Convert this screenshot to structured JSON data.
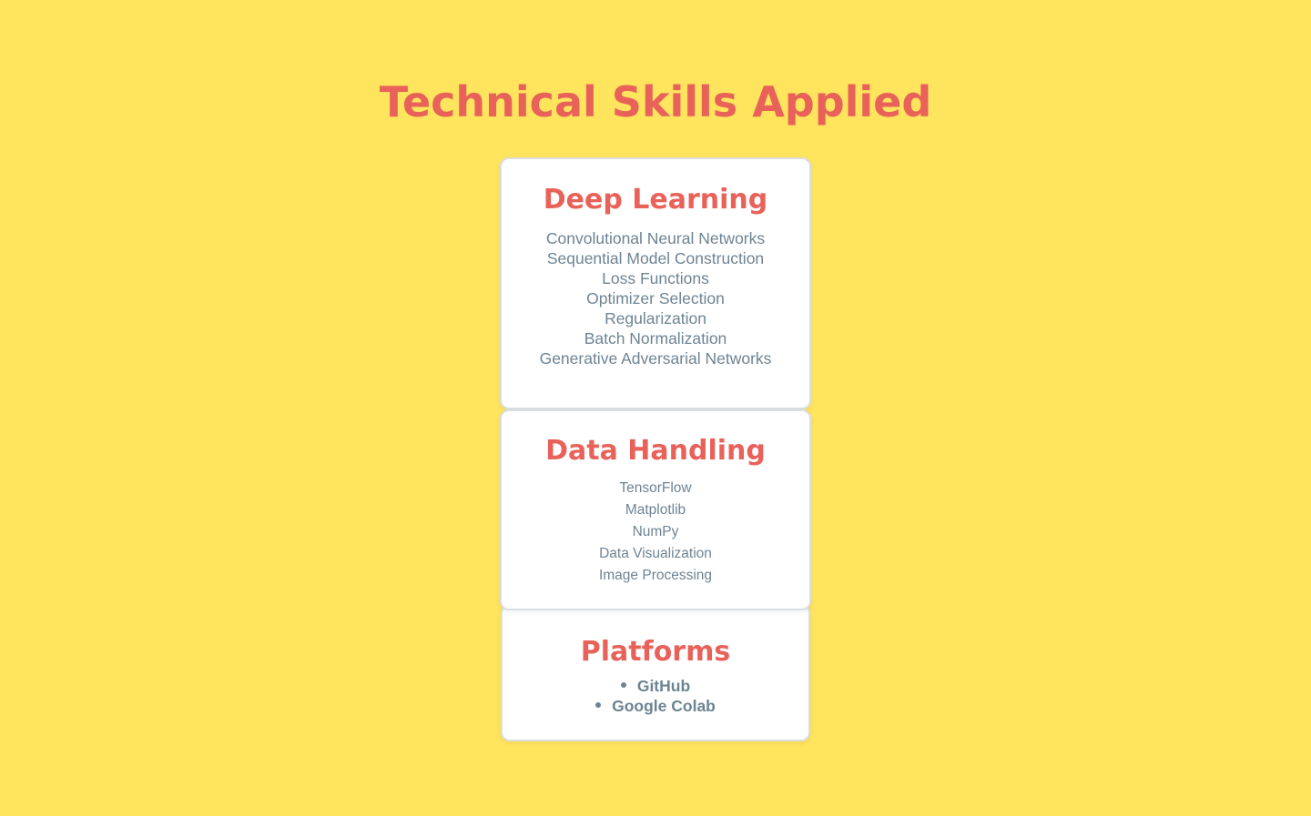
{
  "page": {
    "title": "Technical Skills Applied"
  },
  "colors": {
    "background": "#FFE45E",
    "accent": "#E8625A",
    "text": "#6D8494",
    "card": "#FFFFFF",
    "card_border": "#D9DEE3"
  },
  "cards": [
    {
      "heading": "Deep Learning",
      "items": [
        "Convolutional Neural Networks",
        "Sequential Model Construction",
        "Loss Functions",
        "Optimizer Selection",
        "Regularization",
        "Batch Normalization",
        "Generative Adversarial Networks"
      ]
    },
    {
      "heading": "Data Handling",
      "items": [
        "TensorFlow",
        "Matplotlib",
        "NumPy",
        "Data Visualization",
        "Image Processing"
      ]
    },
    {
      "heading": "Platforms",
      "list_style": "bullet",
      "items": [
        "GitHub",
        "Google Colab"
      ]
    }
  ]
}
